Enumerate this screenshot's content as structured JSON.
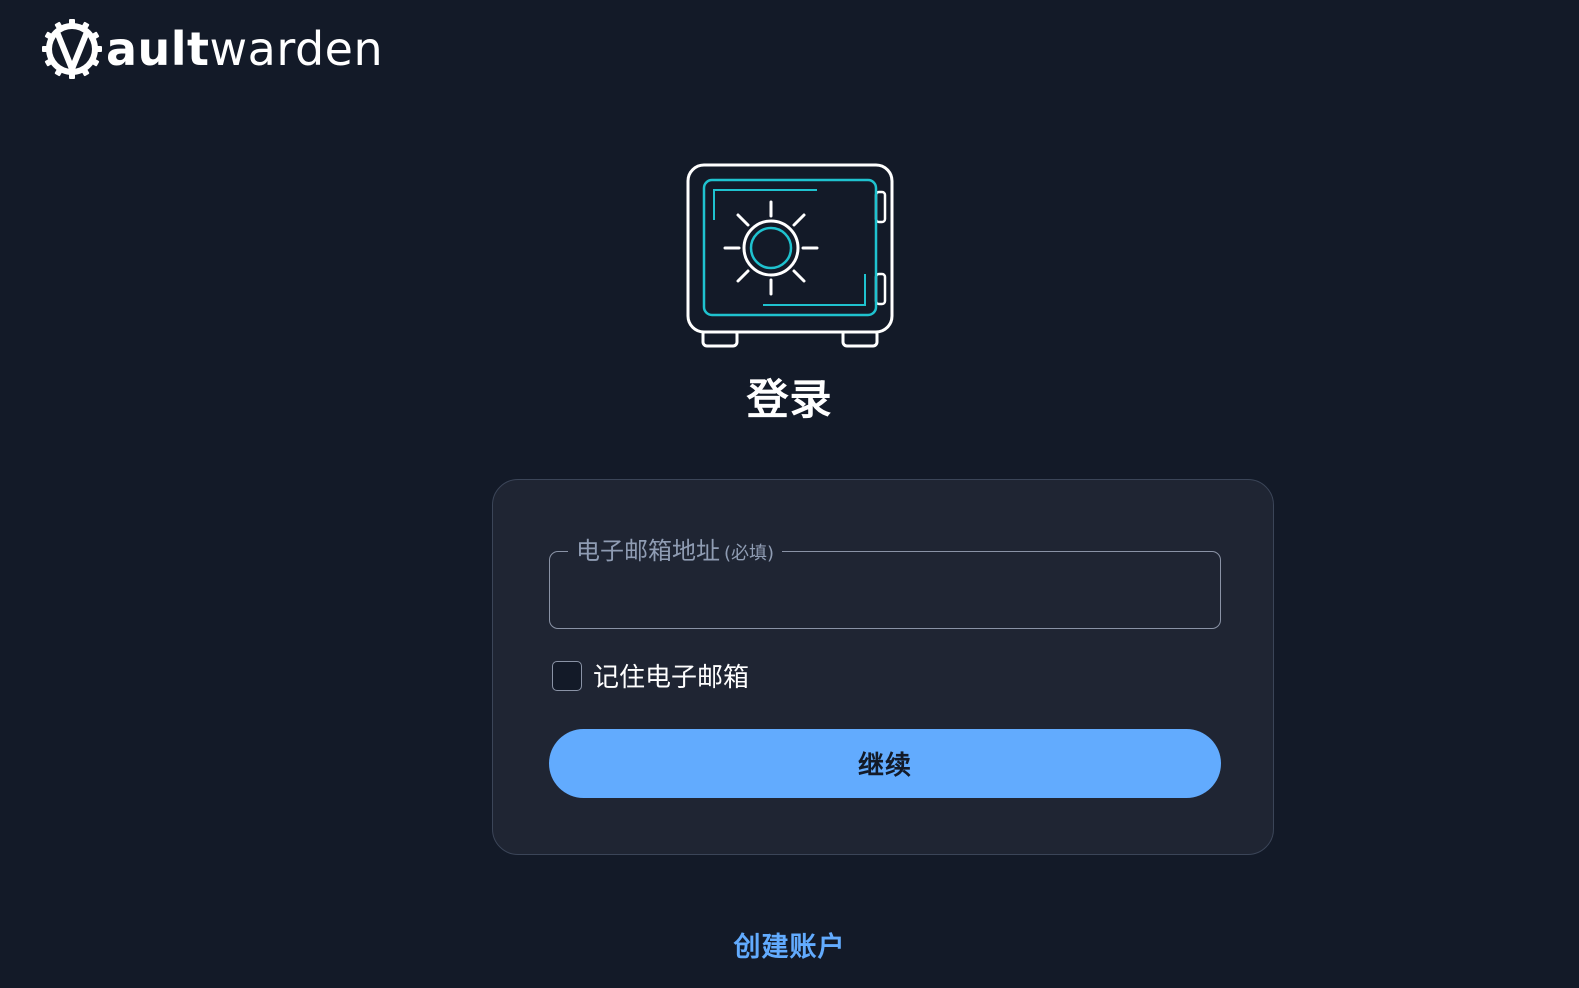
{
  "header": {
    "logo_text_bold": "ault",
    "logo_text_light": "warden"
  },
  "main": {
    "title": "登录",
    "email_label": "电子邮箱地址",
    "email_required": "(必填)",
    "email_value": "",
    "remember_label": "记住电子邮箱",
    "remember_checked": false,
    "continue_label": "继续",
    "create_account_label": "创建账户"
  },
  "colors": {
    "background": "#131a28",
    "card": "#1f2533",
    "accent": "#62abfe",
    "illustration_accent": "#1fc2cf"
  },
  "icons": {
    "logo": "vaultwarden-gear-v-icon",
    "hero": "vault-safe-icon"
  }
}
